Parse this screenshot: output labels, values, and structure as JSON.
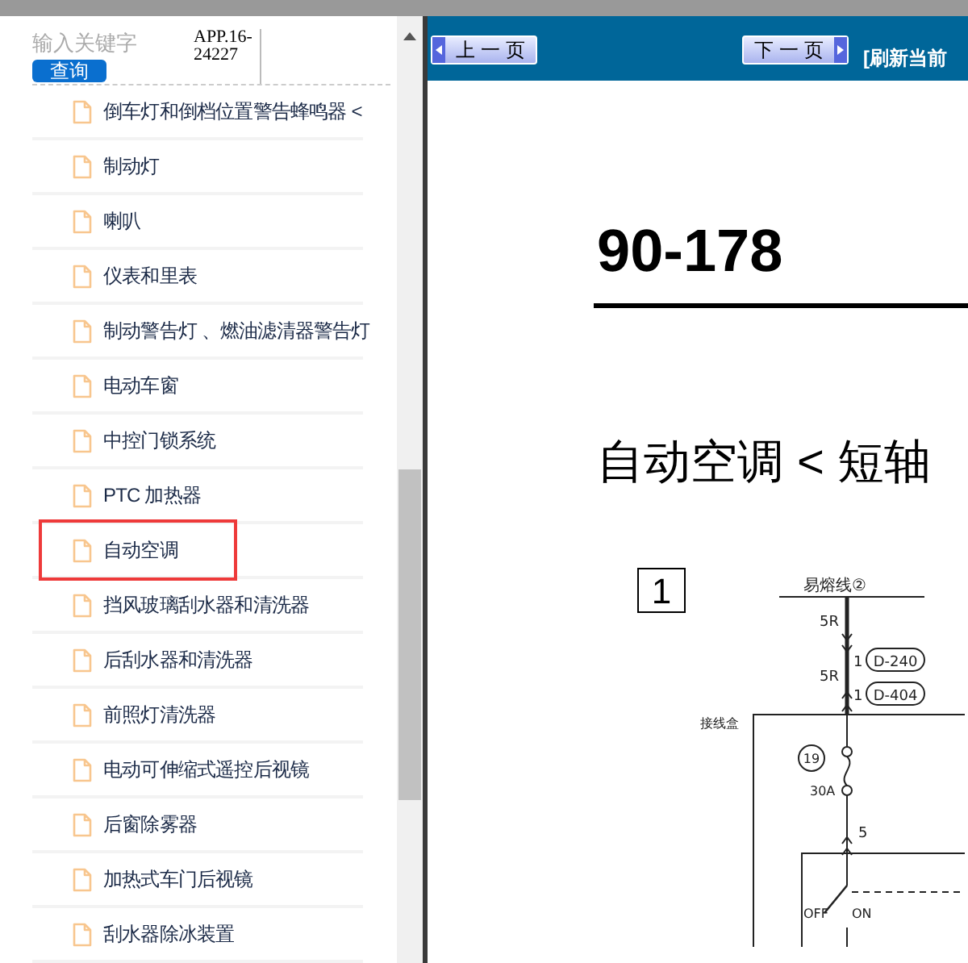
{
  "search": {
    "placeholder": "输入关键字",
    "button": "查询"
  },
  "version": "APP.16-24227",
  "nav_items": [
    {
      "label": "倒车灯和倒档位置警告蜂鸣器 <",
      "highlighted": false
    },
    {
      "label": "制动灯",
      "highlighted": false
    },
    {
      "label": "喇叭",
      "highlighted": false
    },
    {
      "label": "仪表和里表",
      "highlighted": false
    },
    {
      "label": "制动警告灯 、燃油滤清器警告灯",
      "highlighted": false
    },
    {
      "label": "电动车窗",
      "highlighted": false
    },
    {
      "label": "中控门锁系统",
      "highlighted": false
    },
    {
      "label": "PTC 加热器",
      "highlighted": false
    },
    {
      "label": "自动空调",
      "highlighted": true
    },
    {
      "label": "挡风玻璃刮水器和清洗器",
      "highlighted": false
    },
    {
      "label": "后刮水器和清洗器",
      "highlighted": false
    },
    {
      "label": "前照灯清洗器",
      "highlighted": false
    },
    {
      "label": "电动可伸缩式遥控后视镜",
      "highlighted": false
    },
    {
      "label": "后窗除雾器",
      "highlighted": false
    },
    {
      "label": "加热式车门后视镜",
      "highlighted": false
    },
    {
      "label": "刮水器除冰装置",
      "highlighted": false
    }
  ],
  "toolbar": {
    "prev": "上 一 页",
    "next": "下 一 页",
    "refresh": "[刷新当前"
  },
  "page": {
    "number": "90-178",
    "title": "自动空调 < 短轴",
    "figure": "1",
    "diagram_labels": {
      "fusible_link": "易熔线②",
      "wire_1": "5R",
      "wire_2": "5R",
      "connector_1_pin": "1",
      "connector_1": "D-240",
      "connector_2_pin": "1",
      "connector_2": "D-404",
      "junction_box": "接线盒",
      "fuse_no": "19",
      "fuse_rating": "30A",
      "wire_3": "5",
      "switch_off": "OFF",
      "switch_on": "ON"
    }
  }
}
